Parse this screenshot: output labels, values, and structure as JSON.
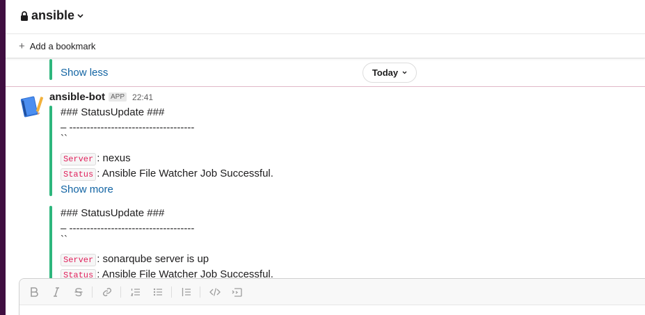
{
  "channel": {
    "name": "ansible"
  },
  "bookmark_bar": {
    "add_label": "Add a bookmark"
  },
  "messages": {
    "prev_dashes": "– ------------------------------------",
    "prev_show_less": "Show less",
    "date_divider": "Today",
    "sender": {
      "name": "ansible-bot",
      "badge": "APP",
      "time": "22:41"
    },
    "attachments": [
      {
        "heading": "### StatusUpdate ###",
        "dashes": "– ------------------------------------",
        "backticks": "``",
        "server_tag": "Server",
        "server_value": ": nexus",
        "status_tag": "Status",
        "status_value": ": Ansible File Watcher Job Successful.",
        "show_more": "Show more"
      },
      {
        "heading": "### StatusUpdate ###",
        "dashes": "– ------------------------------------",
        "backticks": "``",
        "server_tag": "Server",
        "server_value": ": sonarqube server is up",
        "status_tag": "Status",
        "status_value": ": Ansible File Watcher Job Successful."
      }
    ]
  },
  "composer": {
    "toolbar": [
      "bold-icon",
      "italic-icon",
      "strikethrough-icon",
      "link-icon",
      "ordered-list-icon",
      "bulleted-list-icon",
      "blockquote-icon",
      "code-icon",
      "code-block-icon"
    ]
  },
  "colors": {
    "accent_bar": "#2eb67d",
    "link": "#1264a3",
    "code_text": "#e01e5a",
    "sidebar": "#3f0e40"
  }
}
